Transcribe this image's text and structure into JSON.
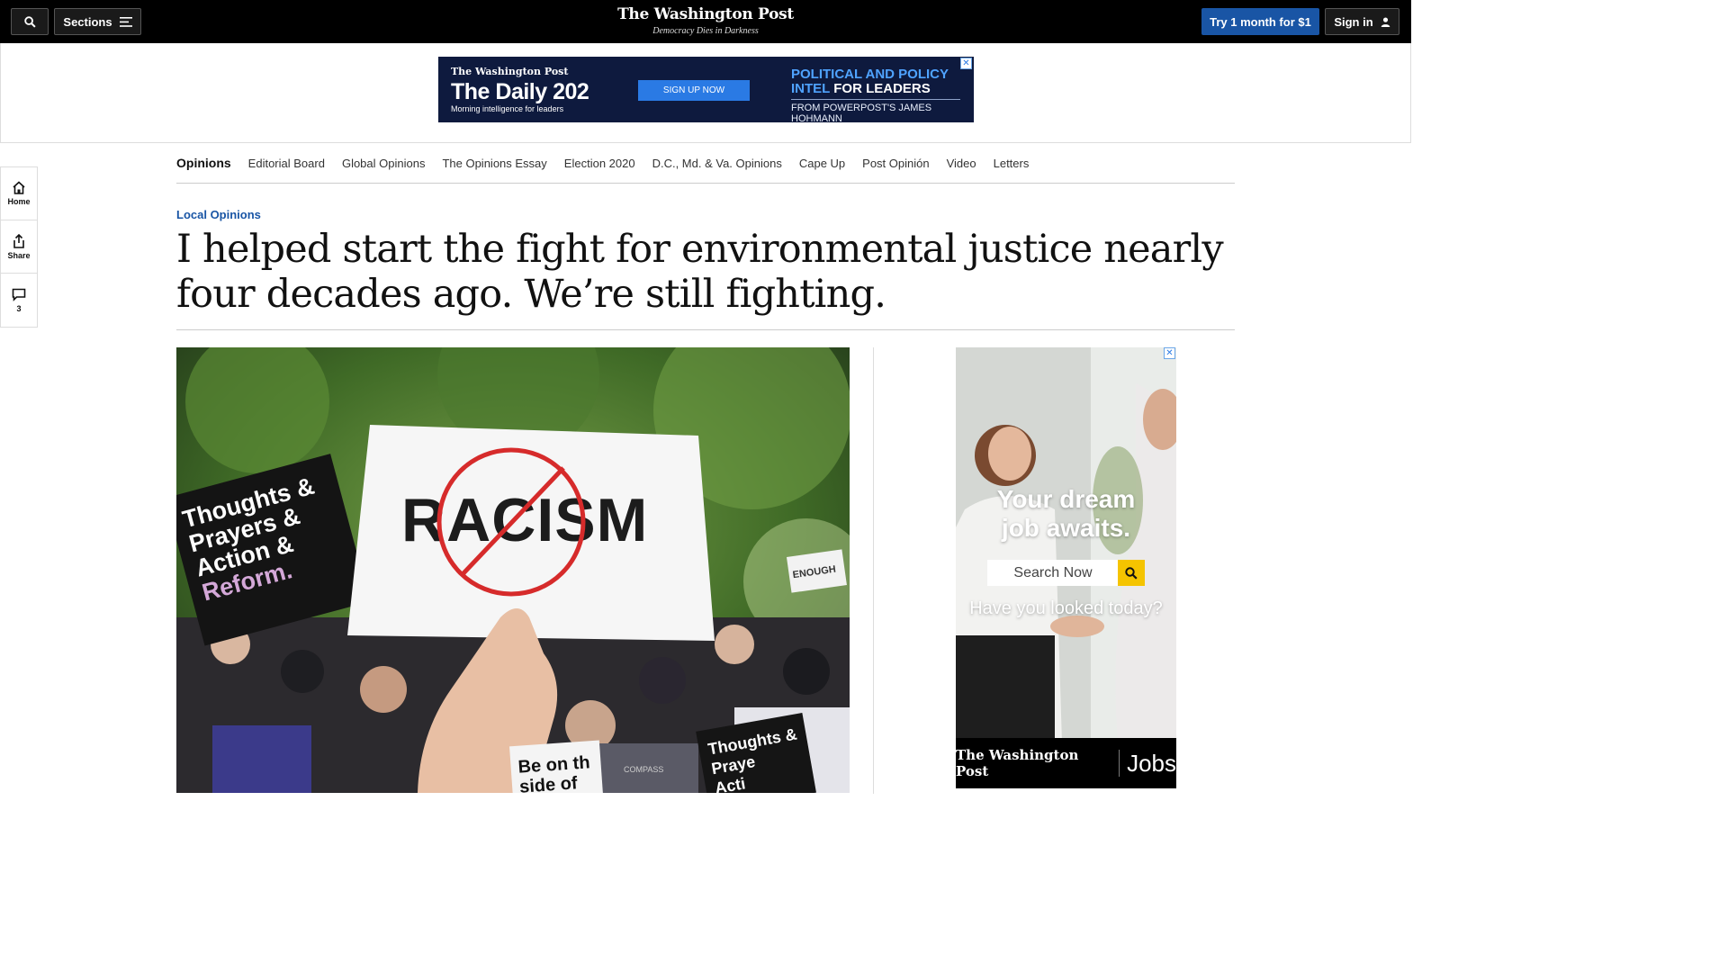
{
  "topbar": {
    "sections_label": "Sections",
    "logo": "The Washington Post",
    "tagline": "Democracy Dies in Darkness",
    "subscribe_label": "Try 1 month for $1",
    "signin_label": "Sign in"
  },
  "banner_ad": {
    "logo": "The Washington Post",
    "title": "The Daily 202",
    "subtitle": "Morning intelligence for leaders",
    "cta": "SIGN UP NOW",
    "headline_blue": "POLITICAL AND POLICY INTEL",
    "headline_white": "FOR LEADERS",
    "from": "FROM POWERPOST'S JAMES HOHMANN",
    "close": "✕"
  },
  "rail": {
    "home_label": "Home",
    "share_label": "Share",
    "comments_count": "3"
  },
  "subnav": {
    "section": "Opinions",
    "items": [
      "Editorial Board",
      "Global Opinions",
      "The Opinions Essay",
      "Election 2020",
      "D.C., Md. & Va. Opinions",
      "Cape Up",
      "Post Opinión",
      "Video",
      "Letters"
    ]
  },
  "article": {
    "kicker": "Local Opinions",
    "headline": "I helped start the fight for environmental justice nearly four decades ago. We’re still fighting."
  },
  "photo": {
    "sign_main": "RACISM",
    "sign_left_lines": [
      "Thoughts &",
      "Prayers &",
      "Action &",
      "Reform."
    ],
    "sign_bottom_left": [
      "Be on th",
      "side of"
    ],
    "sign_bottom_right": [
      "Thoughts &",
      "Praye",
      "Acti"
    ],
    "sign_enough": "ENOUGH",
    "bag_label": "COMPASS"
  },
  "side_ad": {
    "headline_1": "Your dream",
    "headline_2": "job awaits.",
    "search_label": "Search Now",
    "tagline": "Have you looked today?",
    "footer_logo": "The Washington Post",
    "footer_jobs": "Jobs",
    "close": "✕"
  }
}
